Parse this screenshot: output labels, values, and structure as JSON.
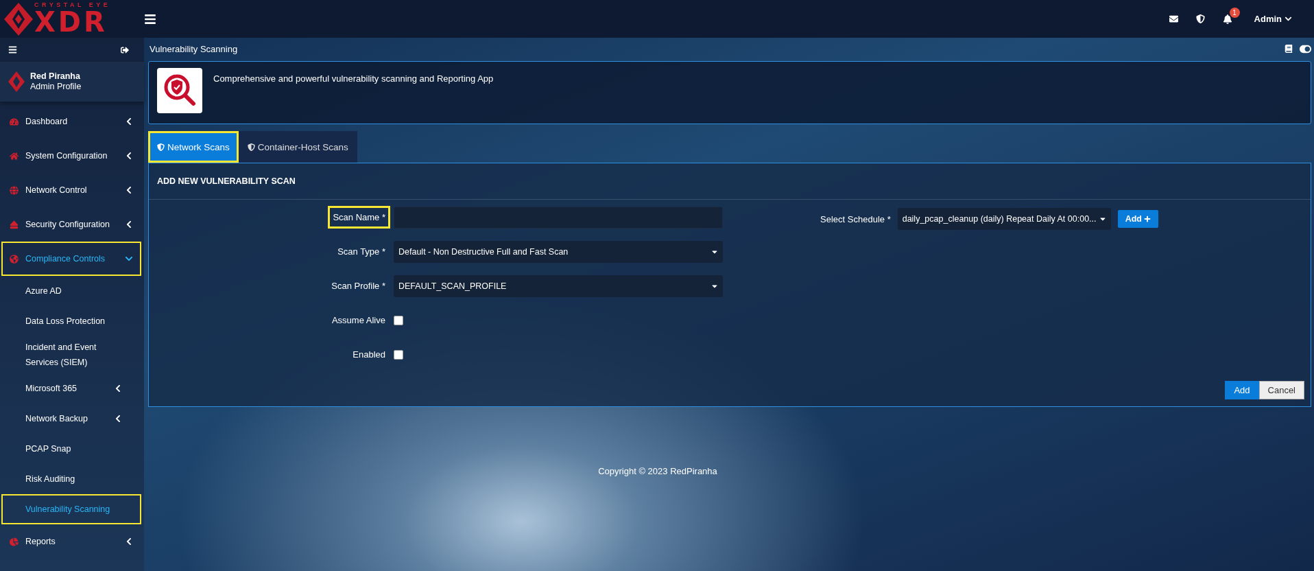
{
  "logo": {
    "tagline": "CRYSTAL EYE",
    "wordmark": "XDR"
  },
  "header": {
    "user": "Admin",
    "notification_count": "1"
  },
  "profile": {
    "name": "Red Piranha",
    "role": "Admin Profile"
  },
  "sidebar": {
    "items": [
      {
        "label": "Dashboard",
        "kind": "group",
        "expanded": false,
        "selected": false,
        "highlighted": false
      },
      {
        "label": "System Configuration",
        "kind": "group",
        "expanded": false,
        "selected": false,
        "highlighted": false
      },
      {
        "label": "Network Control",
        "kind": "group",
        "expanded": false,
        "selected": false,
        "highlighted": false
      },
      {
        "label": "Security Configuration",
        "kind": "group",
        "expanded": false,
        "selected": false,
        "highlighted": false
      },
      {
        "label": "Compliance Controls",
        "kind": "group",
        "expanded": true,
        "selected": true,
        "highlighted": true,
        "children": [
          {
            "label": "Azure AD",
            "kind": "link",
            "selected": false,
            "highlighted": false
          },
          {
            "label": "Data Loss Protection",
            "kind": "link",
            "selected": false,
            "highlighted": false
          },
          {
            "label": "Incident and Event Services (SIEM)",
            "kind": "link",
            "selected": false,
            "highlighted": false
          },
          {
            "label": "Microsoft 365",
            "kind": "group",
            "expanded": false,
            "selected": false,
            "highlighted": false
          },
          {
            "label": "Network Backup",
            "kind": "group",
            "expanded": false,
            "selected": false,
            "highlighted": false
          },
          {
            "label": "PCAP Snap",
            "kind": "link",
            "selected": false,
            "highlighted": false
          },
          {
            "label": "Risk Auditing",
            "kind": "link",
            "selected": false,
            "highlighted": false
          },
          {
            "label": "Vulnerability Scanning",
            "kind": "link",
            "selected": true,
            "highlighted": true
          }
        ]
      },
      {
        "label": "Reports",
        "kind": "group",
        "expanded": false,
        "selected": false,
        "highlighted": false
      }
    ]
  },
  "page": {
    "title": "Vulnerability Scanning",
    "description": "Comprehensive and powerful vulnerability scanning and Reporting App"
  },
  "tabs": [
    {
      "label": "Network Scans",
      "selected": true,
      "highlighted": true
    },
    {
      "label": "Container-Host Scans",
      "selected": false,
      "highlighted": false
    }
  ],
  "form": {
    "title": "ADD NEW VULNERABILITY SCAN",
    "fields": [
      {
        "label": "Scan Name *",
        "kind": "text",
        "highlighted": true
      },
      {
        "label": "Scan Type *",
        "kind": "select",
        "value": "Default - Non Destructive Full and Fast Scan",
        "highlighted": false
      },
      {
        "label": "Scan Profile *",
        "kind": "select",
        "value": "DEFAULT_SCAN_PROFILE",
        "highlighted": false
      },
      {
        "label": "Assume Alive",
        "kind": "checkbox",
        "checked": false,
        "highlighted": false
      },
      {
        "label": "Enabled",
        "kind": "checkbox",
        "checked": false,
        "highlighted": false
      }
    ],
    "schedule": {
      "label": "Select Schedule *",
      "value": "daily_pcap_cleanup (daily) Repeat Daily At 00:00...",
      "add_button": "Add"
    },
    "buttons": [
      {
        "label": "Add",
        "kind": "primary"
      },
      {
        "label": "Cancel",
        "kind": "secondary"
      }
    ]
  },
  "footer": {
    "copyright": "Copyright © 2023 RedPiranha"
  }
}
